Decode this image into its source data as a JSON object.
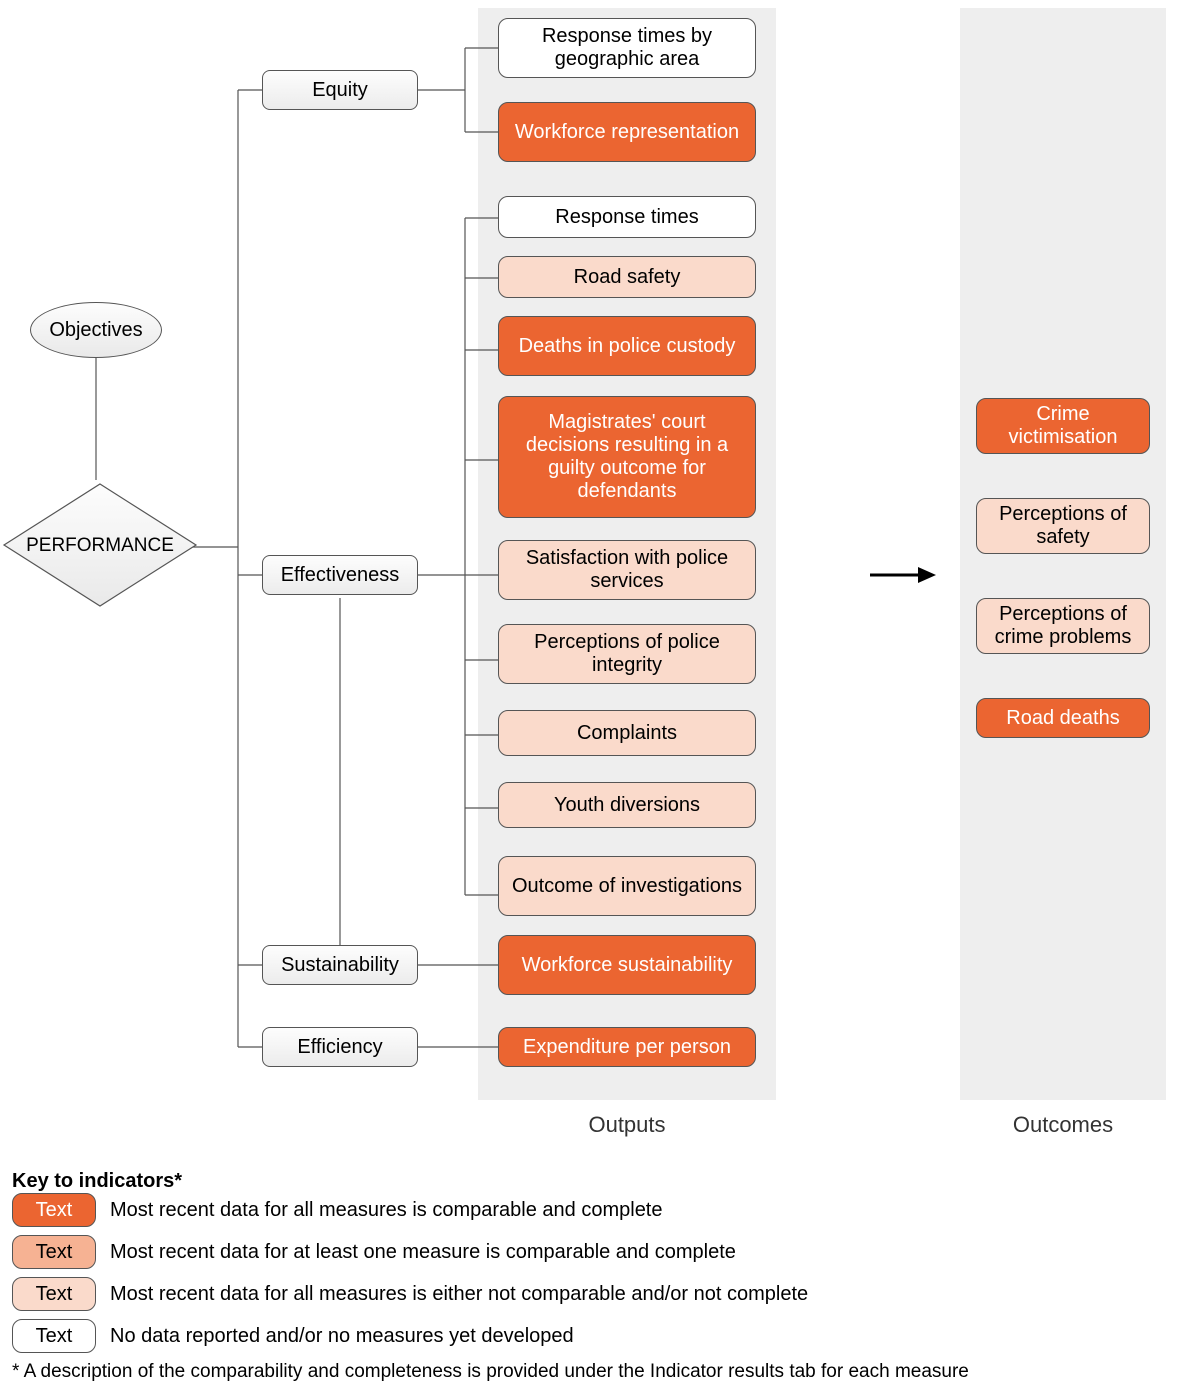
{
  "root": {
    "objectives": "Objectives",
    "performance": "PERFORMANCE",
    "categories": {
      "equity": "Equity",
      "effectiveness": "Effectiveness",
      "sustainability": "Sustainability",
      "efficiency": "Efficiency"
    }
  },
  "outputs_label": "Outputs",
  "outcomes_label": "Outcomes",
  "outputs": {
    "equity": [
      {
        "label": "Response times by geographic area",
        "level": "none"
      },
      {
        "label": "Workforce representation",
        "level": "full"
      }
    ],
    "effectiveness": [
      {
        "label": "Response times",
        "level": "none"
      },
      {
        "label": "Road safety",
        "level": "weak"
      },
      {
        "label": "Deaths in police custody",
        "level": "full"
      },
      {
        "label": "Magistrates' court decisions resulting in a guilty outcome for defendants",
        "level": "full"
      },
      {
        "label": "Satisfaction with police services",
        "level": "weak"
      },
      {
        "label": "Perceptions of police integrity",
        "level": "weak"
      },
      {
        "label": "Complaints",
        "level": "weak"
      },
      {
        "label": "Youth diversions",
        "level": "weak"
      },
      {
        "label": "Outcome of investigations",
        "level": "weak"
      }
    ],
    "sustainability": [
      {
        "label": "Workforce sustainability",
        "level": "full"
      }
    ],
    "efficiency": [
      {
        "label": "Expenditure per person",
        "level": "full"
      }
    ]
  },
  "outcomes": [
    {
      "label": "Crime victimisation",
      "level": "full"
    },
    {
      "label": "Perceptions of safety",
      "level": "weak"
    },
    {
      "label": "Perceptions of crime problems",
      "level": "weak"
    },
    {
      "label": "Road deaths",
      "level": "full"
    }
  ],
  "key": {
    "title": "Key to indicators*",
    "swatch_text": "Text",
    "items": [
      {
        "level": "full",
        "desc": "Most recent data for all measures is comparable and complete"
      },
      {
        "level": "part",
        "desc": "Most recent data for at least one measure is comparable and complete"
      },
      {
        "level": "weak",
        "desc": "Most recent data for all measures is either not comparable and/or not complete"
      },
      {
        "level": "none",
        "desc": "No data reported and/or no measures yet developed"
      }
    ],
    "footnote": "* A description of the comparability and completeness is provided under the Indicator results tab for each measure"
  },
  "colors": {
    "full": "#eb6531",
    "part": "#f6b293",
    "weak": "#fadacb",
    "none": "#ffffff"
  }
}
